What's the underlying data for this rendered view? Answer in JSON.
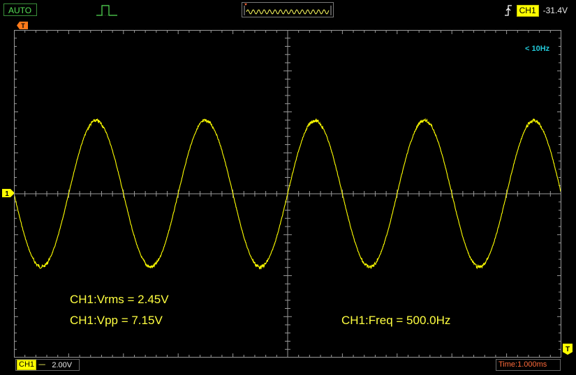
{
  "topbar": {
    "mode_label": "AUTO",
    "trigger_channel": "CH1",
    "trigger_level": "-31.4V",
    "icons": {
      "pulse": "trigger-pulse-icon",
      "memory": "memory-overview-icon",
      "edge": "rising-edge-icon"
    }
  },
  "screen": {
    "freq_note": "< 10Hz",
    "ground_marker": "1",
    "trigger_marker": "T"
  },
  "measurements": {
    "vrms": "CH1:Vrms = 2.45V",
    "vpp": "CH1:Vpp = 7.15V",
    "freq": "CH1:Freq = 500.0Hz"
  },
  "bottombar": {
    "channel": "CH1",
    "coupling": "----",
    "volts_div": "2.00V",
    "time_div": "Time:1.000ms"
  },
  "colors": {
    "trace": "#ffff00",
    "grid": "#9a9a9a",
    "cyan_note": "#22c8d8",
    "time_label": "#ff6a3a",
    "mode_label": "#55e055"
  },
  "waveform": {
    "frequency_hz": 500,
    "vpp": 7.15,
    "time_per_div_ms": 1.0,
    "volts_per_div": 2.0
  }
}
